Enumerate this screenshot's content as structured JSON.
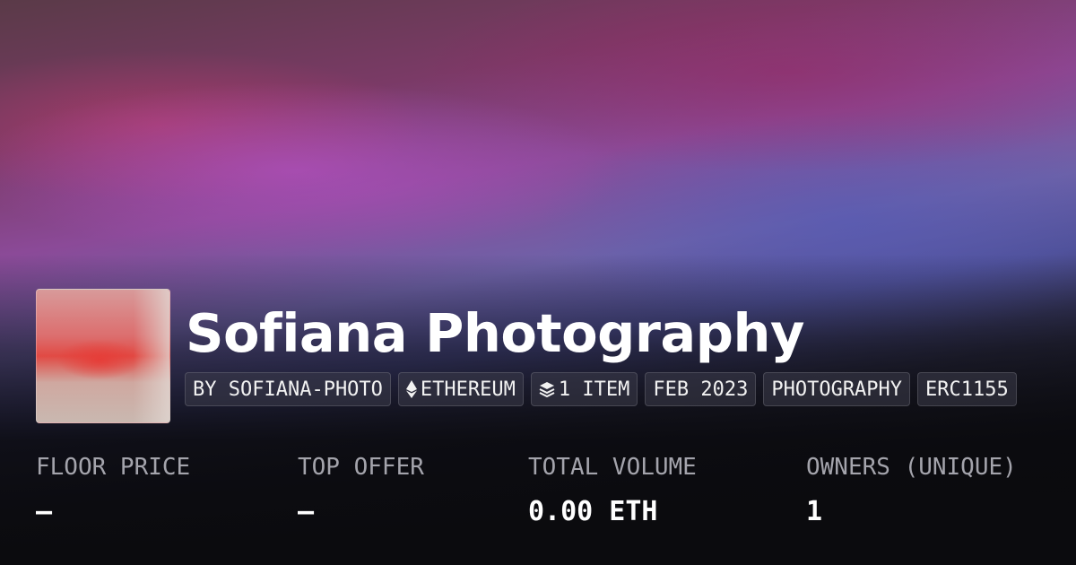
{
  "collection": {
    "name": "Sofiana Photography",
    "tags": [
      {
        "label": "BY SOFIANA-PHOTO",
        "icon": null
      },
      {
        "label": "ETHEREUM",
        "icon": "ethereum-icon"
      },
      {
        "label": "1 ITEM",
        "icon": "layers-icon"
      },
      {
        "label": "FEB 2023",
        "icon": null
      },
      {
        "label": "PHOTOGRAPHY",
        "icon": null
      },
      {
        "label": "ERC1155",
        "icon": null
      }
    ]
  },
  "stats": [
    {
      "label": "FLOOR PRICE",
      "value": "—"
    },
    {
      "label": "TOP OFFER",
      "value": "—"
    },
    {
      "label": "TOTAL VOLUME",
      "value": "0.00 ETH"
    },
    {
      "label": "OWNERS (UNIQUE)",
      "value": "1"
    }
  ],
  "colors": {
    "background": "#0d0d10",
    "muted_text": "#a4a4ac",
    "tag_background": "#3c3c4b"
  }
}
